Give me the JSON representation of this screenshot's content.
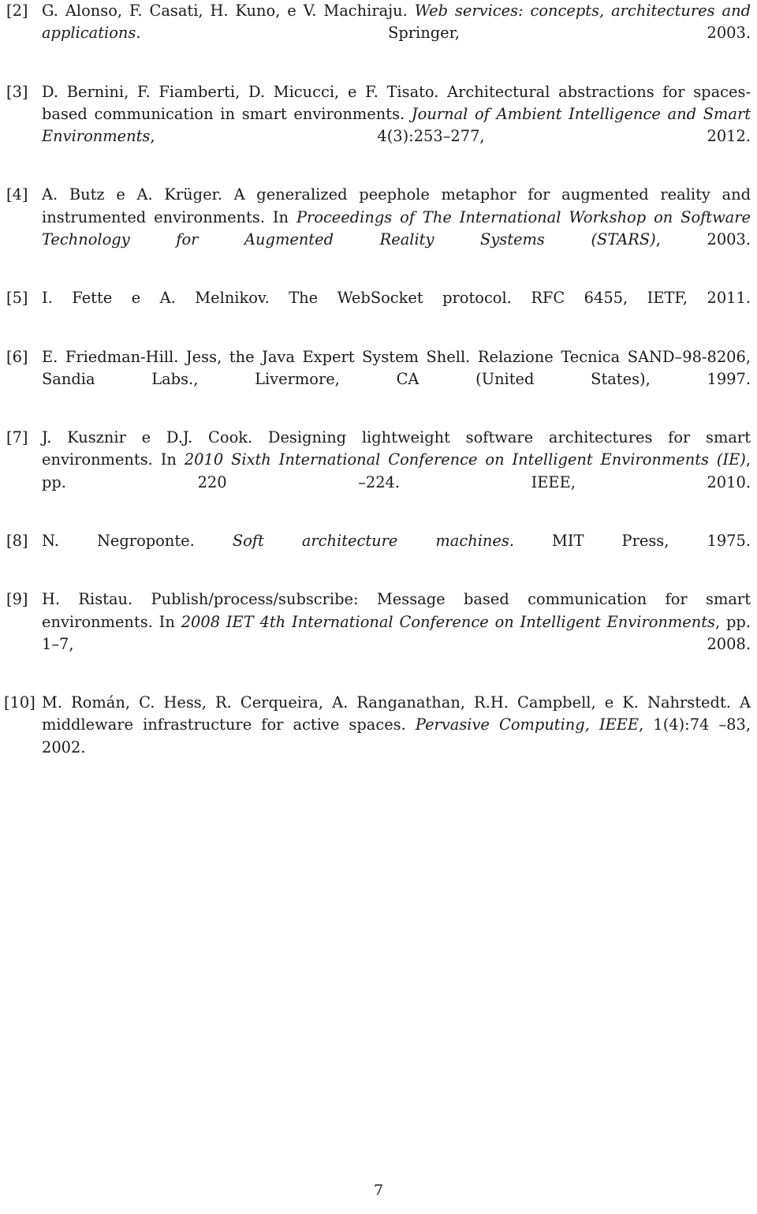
{
  "document": {
    "page_number": "7",
    "section": "bibliography"
  },
  "references": [
    {
      "label": "[2]",
      "parts": [
        {
          "text": "G. Alonso, F. Casati, H. Kuno, e V. Machiraju. ",
          "style": "roman"
        },
        {
          "text": "Web services: concepts, architectures and applications",
          "style": "italic"
        },
        {
          "text": ". Springer, 2003.",
          "style": "roman"
        }
      ]
    },
    {
      "label": "[3]",
      "parts": [
        {
          "text": "D. Bernini, F. Fiamberti, D. Micucci, e F. Tisato. Architectural abstractions for spaces-based communication in smart environments. ",
          "style": "roman"
        },
        {
          "text": "Journal of Ambient Intelligence and Smart Environments",
          "style": "italic"
        },
        {
          "text": ", 4(3):253–277, 2012.",
          "style": "roman"
        }
      ]
    },
    {
      "label": "[4]",
      "parts": [
        {
          "text": "A. Butz e A. Krüger. A generalized peephole metaphor for augmented reality and instrumented environments. In ",
          "style": "roman"
        },
        {
          "text": "Proceedings of The International Workshop on Software Technology for Augmented Reality Systems (STARS)",
          "style": "italic"
        },
        {
          "text": ", 2003.",
          "style": "roman"
        }
      ]
    },
    {
      "label": "[5]",
      "parts": [
        {
          "text": "I. Fette e A. Melnikov. The WebSocket protocol. RFC 6455, IETF, 2011.",
          "style": "roman"
        }
      ]
    },
    {
      "label": "[6]",
      "parts": [
        {
          "text": "E. Friedman-Hill. Jess, the Java Expert System Shell. Relazione Tecnica SAND–98-8206, Sandia Labs., Livermore, CA (United States), 1997.",
          "style": "roman"
        }
      ]
    },
    {
      "label": "[7]",
      "parts": [
        {
          "text": "J. Kusznir e D.J. Cook. Designing lightweight software architectures for smart environments. In ",
          "style": "roman"
        },
        {
          "text": "2010 Sixth International Conference on Intelligent Environments (IE)",
          "style": "italic"
        },
        {
          "text": ", pp. 220 –224. IEEE, 2010.",
          "style": "roman"
        }
      ]
    },
    {
      "label": "[8]",
      "parts": [
        {
          "text": "N. Negroponte. ",
          "style": "roman"
        },
        {
          "text": "Soft architecture machines",
          "style": "italic"
        },
        {
          "text": ". MIT Press, 1975.",
          "style": "roman"
        }
      ]
    },
    {
      "label": "[9]",
      "parts": [
        {
          "text": "H. Ristau. Publish/process/subscribe: Message based communication for smart environments. In ",
          "style": "roman"
        },
        {
          "text": "2008 IET 4th International Conference on Intelligent Environments",
          "style": "italic"
        },
        {
          "text": ", pp. 1–7, 2008.",
          "style": "roman"
        }
      ]
    },
    {
      "label": "[10]",
      "parts": [
        {
          "text": "M. Román, C. Hess, R. Cerqueira, A. Ranganathan, R.H. Campbell, e K. Nahrstedt. A middleware infrastructure for active spaces. ",
          "style": "roman"
        },
        {
          "text": "Pervasive Computing, IEEE",
          "style": "italic"
        },
        {
          "text": ", 1(4):74 –83, 2002.",
          "style": "roman"
        }
      ]
    }
  ]
}
